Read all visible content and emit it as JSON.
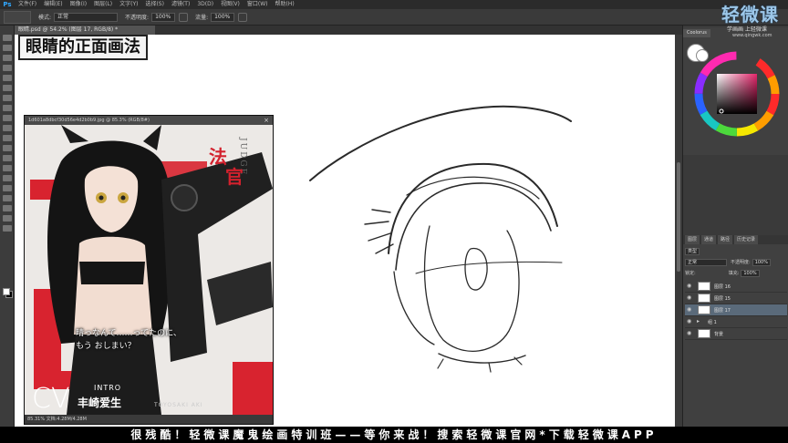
{
  "menubar": {
    "logo": "Ps",
    "items": [
      "文件(F)",
      "编辑(E)",
      "图像(I)",
      "图层(L)",
      "文字(Y)",
      "选择(S)",
      "滤镜(T)",
      "3D(D)",
      "视图(V)",
      "窗口(W)",
      "帮助(H)"
    ]
  },
  "options": {
    "mode_label": "模式:",
    "mode_value": "正常",
    "opacity_label": "不透明度:",
    "opacity_value": "100%",
    "flow_label": "流量:",
    "flow_value": "100%"
  },
  "document": {
    "tab_title": "眼睛.psd @ 54.2% (图层 17, RGB/8) *",
    "overlay_title": "眼睛的正面画法"
  },
  "reference": {
    "window_title": "1d601a8dbcf30d56e4d2b0b9.jpg @ 85.3% (RGB/8#)",
    "close": "×",
    "judge": "JUDGE",
    "kanji_1": "法",
    "kanji_2": "官",
    "quote_line1": "晴っなんて……ってたのに、",
    "quote_line2": "もう おしまい？",
    "intro": "INTRO",
    "cv": "CV",
    "va_name": "丰崎爱生",
    "va_romaji": "TOYOSAKI AKI",
    "status": "85.31%   文档:4.28M/4.28M"
  },
  "watermark": {
    "big": "轻微课",
    "small": "学画画 上轻微课",
    "url": "www.qingwk.com"
  },
  "colors_panel": {
    "tab": "Coolorus"
  },
  "layers_panel": {
    "tabs": [
      "图层",
      "通道",
      "路径",
      "历史记录"
    ],
    "kind_label": "类型",
    "blend_mode": "正常",
    "opacity_label": "不透明度:",
    "opacity_value": "100%",
    "fill_label": "填充:",
    "fill_value": "100%",
    "lock_label": "锁定:",
    "layers": [
      {
        "name": "图层 16",
        "active": false
      },
      {
        "name": "图层 15",
        "active": false
      },
      {
        "name": "图层 17",
        "active": true
      },
      {
        "name": "组 1",
        "active": false
      },
      {
        "name": "背景",
        "active": false
      }
    ]
  },
  "caption": "很残酷！轻微课魔鬼绘画特训班——等你来战！搜索轻微课官网*下载轻微课APP"
}
